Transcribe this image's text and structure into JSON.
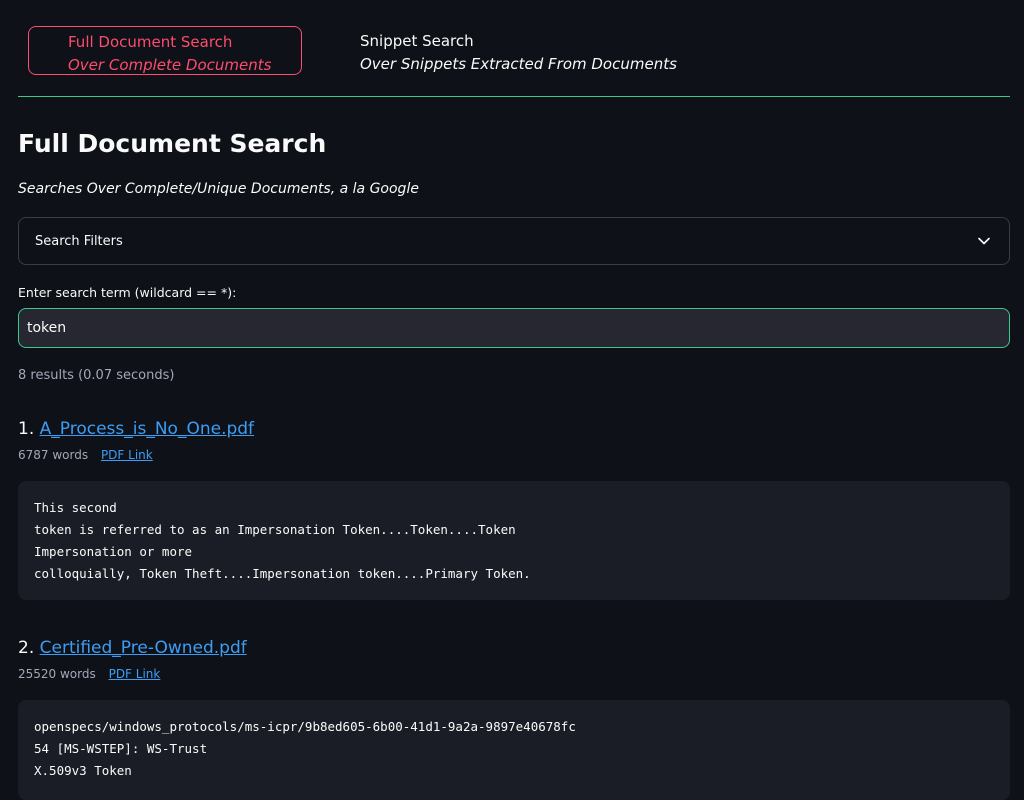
{
  "nav": {
    "tabs": [
      {
        "title": "Full Document Search",
        "subtitle": "Over Complete Documents",
        "active": true
      },
      {
        "title": "Snippet Search",
        "subtitle": "Over Snippets Extracted From Documents",
        "active": false
      }
    ]
  },
  "page": {
    "title": "Full Document Search",
    "subtitle": "Searches Over Complete/Unique Documents, a la Google"
  },
  "filters": {
    "label": "Search Filters",
    "icon": "chevron-down-icon"
  },
  "search": {
    "label": "Enter search term (wildcard == *):",
    "value": "token"
  },
  "results_summary": "8 results (0.07 seconds)",
  "results": [
    {
      "index": "1.",
      "filename": "A_Process_is_No_One.pdf",
      "words": "6787 words",
      "link_label": "PDF Link",
      "snippet": "This second\ntoken is referred to as an Impersonation Token....Token....Token\nImpersonation or more\ncolloquially, Token Theft....Impersonation token....Primary Token."
    },
    {
      "index": "2.",
      "filename": "Certified_Pre-Owned.pdf",
      "words": "25520 words",
      "link_label": "PDF Link",
      "snippet": "openspecs/windows_protocols/ms-icpr/9b8ed605-6b00-41d1-9a2a-9897e40678fc\n54 [MS-WSTEP]: WS-Trust\nX.509v3 Token"
    }
  ],
  "colors": {
    "background": "#0e1117",
    "accent": "#ff4b6e",
    "divider": "#3ec98a",
    "link": "#3d9df3"
  }
}
